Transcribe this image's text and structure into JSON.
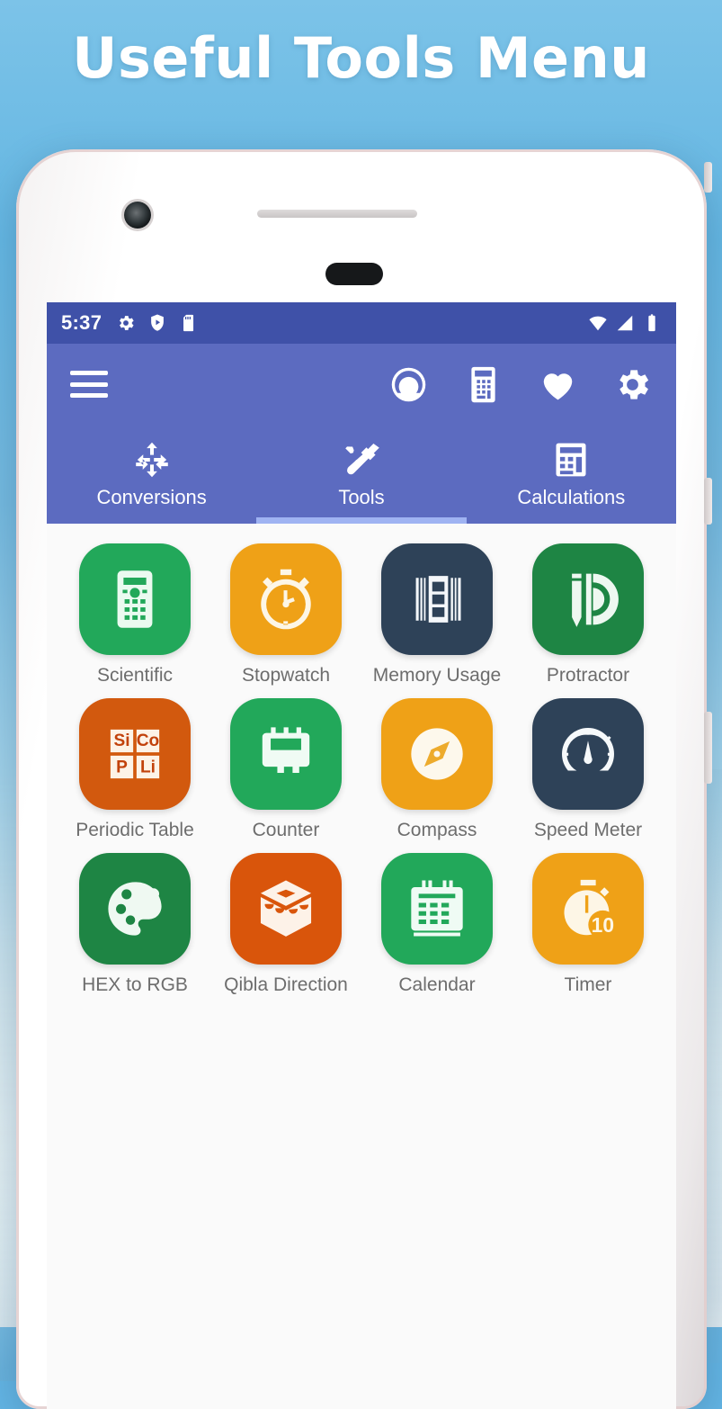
{
  "headline": "Useful Tools Menu",
  "colors": {
    "background_sky": "#63b4e3",
    "status_bar": "#3f51a8",
    "app_bar": "#5c6bc0",
    "tab_indicator": "#9fb3f2",
    "screen_background": "#fafafa",
    "label_text": "#6d6d6d"
  },
  "status_bar": {
    "time": "5:37",
    "left_icons": [
      "gear-icon",
      "shield-play-icon",
      "sd-card-icon"
    ],
    "right_icons": [
      "wifi-icon",
      "cellular-signal-icon",
      "battery-icon"
    ]
  },
  "app_bar": {
    "menu_icon": "hamburger-menu-icon",
    "actions": [
      {
        "name": "speed-meter-icon"
      },
      {
        "name": "calculator-icon"
      },
      {
        "name": "favorites-heart-icon"
      },
      {
        "name": "settings-gear-icon"
      }
    ]
  },
  "tabs": [
    {
      "label": "Conversions",
      "icon": "conversions-icon",
      "active": false
    },
    {
      "label": "Tools",
      "icon": "tools-icon",
      "active": true
    },
    {
      "label": "Calculations",
      "icon": "calculations-icon",
      "active": false
    }
  ],
  "tools": [
    {
      "label": "Scientific",
      "icon": "scientific-calculator-icon",
      "color": "#22a85a"
    },
    {
      "label": "Stopwatch",
      "icon": "stopwatch-icon",
      "color": "#efa117"
    },
    {
      "label": "Memory Usage",
      "icon": "memory-chip-icon",
      "color": "#2e4258"
    },
    {
      "label": "Protractor",
      "icon": "protractor-pencil-icon",
      "color": "#1e8544"
    },
    {
      "label": "Periodic Table",
      "icon": "periodic-table-icon",
      "color": "#d2590e"
    },
    {
      "label": "Counter",
      "icon": "tally-counter-icon",
      "color": "#22a85a"
    },
    {
      "label": "Compass",
      "icon": "compass-icon",
      "color": "#efa117"
    },
    {
      "label": "Speed Meter",
      "icon": "speed-meter-gauge-icon",
      "color": "#2e4258"
    },
    {
      "label": "HEX to RGB",
      "icon": "color-palette-icon",
      "color": "#1e8544"
    },
    {
      "label": "Qibla Direction",
      "icon": "kaaba-icon",
      "color": "#d9550b"
    },
    {
      "label": "Calendar",
      "icon": "calendar-icon",
      "color": "#22a85a"
    },
    {
      "label": "Timer",
      "icon": "timer-10-icon",
      "color": "#efa117"
    }
  ],
  "phone": {
    "camera": "front-camera",
    "speaker": "earpiece-speaker",
    "sensor": "proximity-sensor"
  }
}
